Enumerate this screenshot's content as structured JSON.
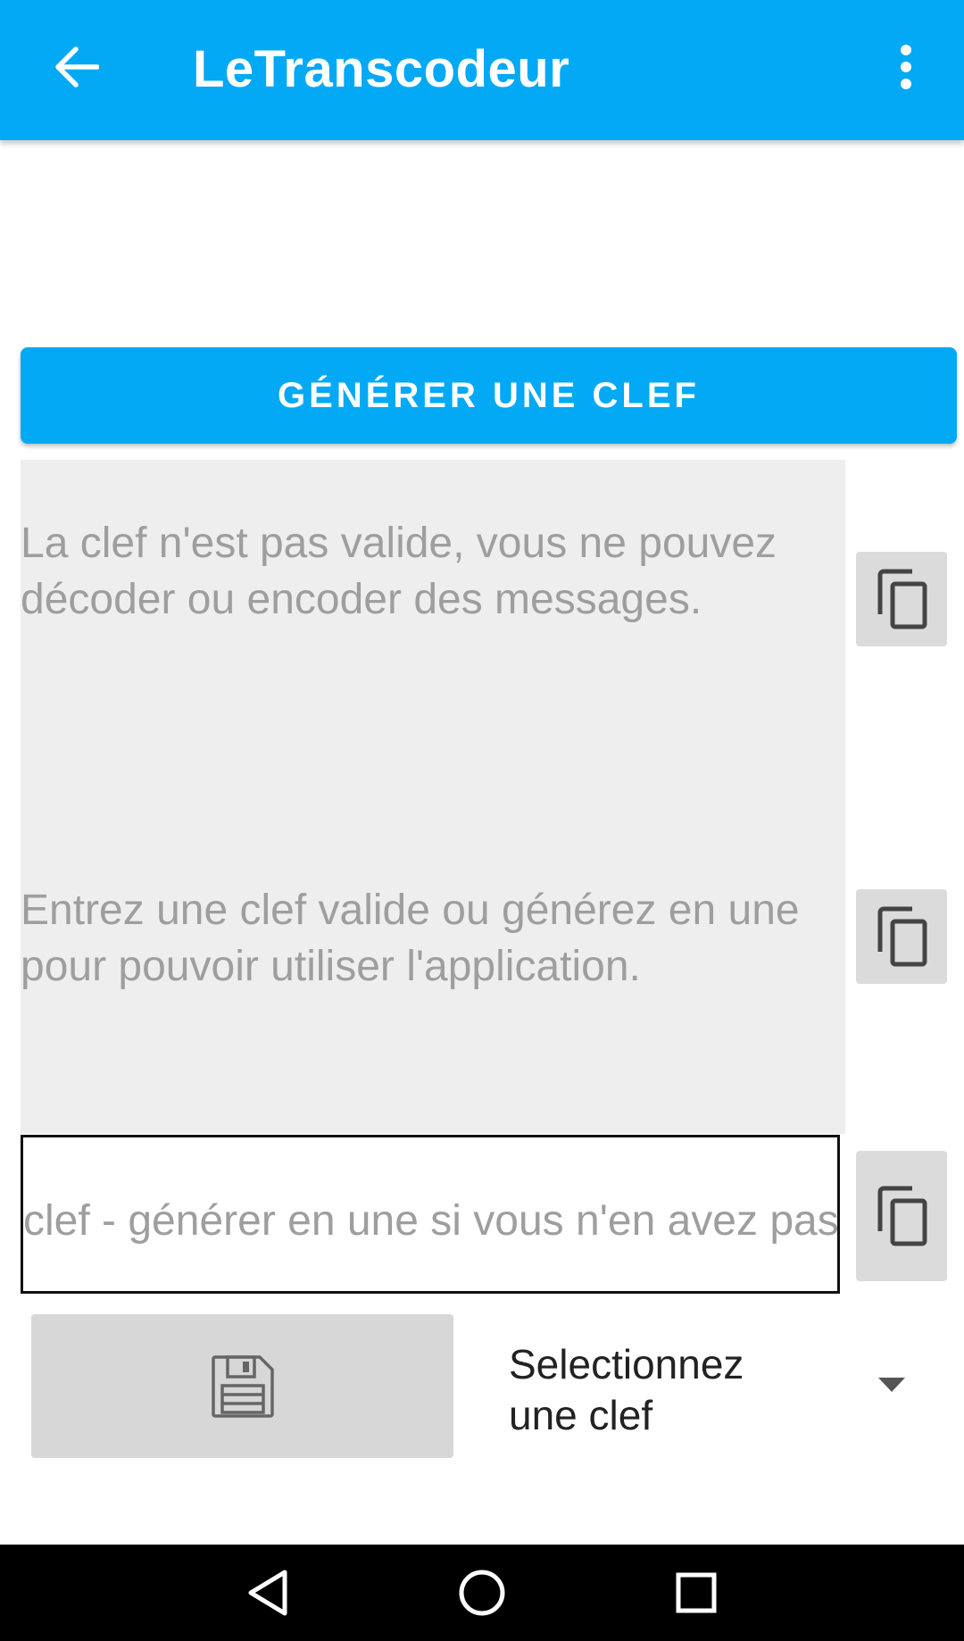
{
  "app_bar": {
    "title": "LeTranscodeur",
    "back_icon": "arrow-back-icon",
    "menu_icon": "more-vert-icon",
    "color": "#03A9F4"
  },
  "generate_button": {
    "label": "GÉNÉRER UNE CLEF"
  },
  "messages": {
    "message_1": "La clef n'est pas valide, vous ne pouvez décoder ou encoder des messages.",
    "message_2": "Entrez une clef valide ou générez en une pour pouvoir utiliser l'application."
  },
  "copy_buttons": {
    "icon": "copy-icon"
  },
  "key_input": {
    "value": "",
    "placeholder": "clef - générer en une si vous n'en avez pas"
  },
  "save_button": {
    "icon": "save-icon"
  },
  "key_select": {
    "selected": "Selectionnez une clef",
    "icon": "dropdown-arrow-icon"
  },
  "nav_bar": {
    "back_icon": "nav-back-icon",
    "home_icon": "nav-home-icon",
    "recent_icon": "nav-recent-icon"
  }
}
